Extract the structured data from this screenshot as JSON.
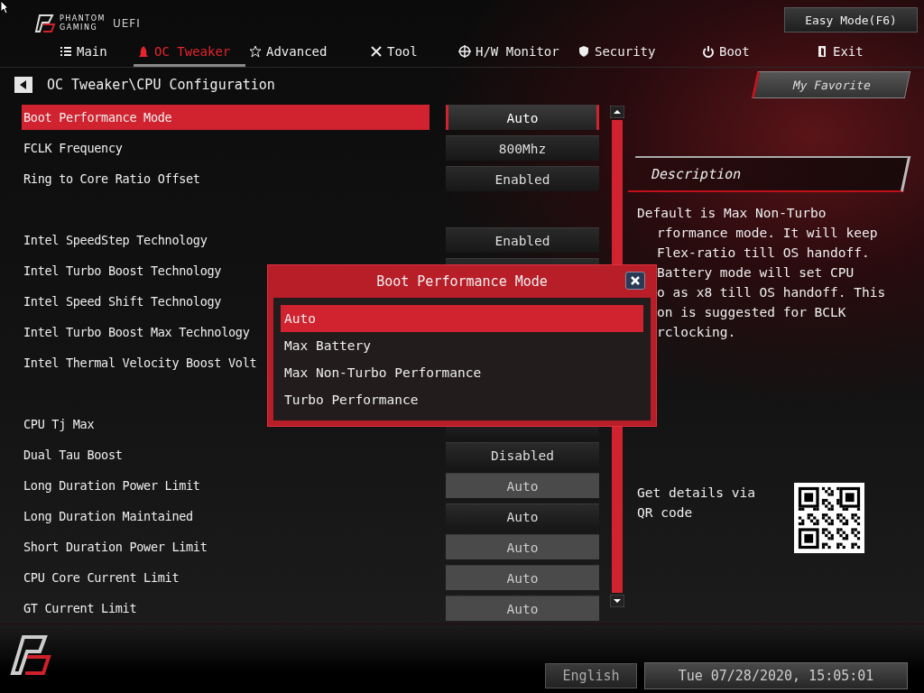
{
  "brand": {
    "name_line1": "PHANTOM",
    "name_line2": "GAMING",
    "suffix": "UEFI"
  },
  "easy_mode_button": "Easy Mode(F6)",
  "tabs": [
    {
      "label": "Main",
      "selected": false
    },
    {
      "label": "OC Tweaker",
      "selected": true
    },
    {
      "label": "Advanced",
      "selected": false
    },
    {
      "label": "Tool",
      "selected": false
    },
    {
      "label": "H/W Monitor",
      "selected": false
    },
    {
      "label": "Security",
      "selected": false
    },
    {
      "label": "Boot",
      "selected": false
    },
    {
      "label": "Exit",
      "selected": false
    }
  ],
  "breadcrumb": "OC Tweaker\\CPU Configuration",
  "favorite_button": "My Favorite",
  "settings": [
    {
      "kind": "setting",
      "label": "Boot Performance Mode",
      "value": "Auto",
      "selected": true,
      "disabled": false
    },
    {
      "kind": "setting",
      "label": "FCLK Frequency",
      "value": "800Mhz",
      "selected": false,
      "disabled": false
    },
    {
      "kind": "setting",
      "label": "Ring to Core Ratio Offset",
      "value": "Enabled",
      "selected": false,
      "disabled": false
    },
    {
      "kind": "spacer"
    },
    {
      "kind": "setting",
      "label": "Intel SpeedStep Technology",
      "value": "Enabled",
      "selected": false,
      "disabled": false
    },
    {
      "kind": "setting",
      "label": "Intel Turbo Boost Technology",
      "selected": false
    },
    {
      "kind": "setting",
      "label": "Intel Speed Shift Technology",
      "selected": false
    },
    {
      "kind": "setting",
      "label": "Intel Turbo Boost Max Technology",
      "selected": false
    },
    {
      "kind": "setting",
      "label": "Intel Thermal Velocity Boost Volt",
      "selected": false
    },
    {
      "kind": "spacer"
    },
    {
      "kind": "setting",
      "label": "CPU Tj Max",
      "selected": false
    },
    {
      "kind": "setting",
      "label": "Dual Tau Boost",
      "value": "Disabled",
      "selected": false,
      "disabled": false
    },
    {
      "kind": "setting",
      "label": "Long Duration Power Limit",
      "value": "Auto",
      "selected": false,
      "disabled": true
    },
    {
      "kind": "setting",
      "label": "Long Duration Maintained",
      "value": "Auto",
      "selected": false,
      "disabled": false
    },
    {
      "kind": "setting",
      "label": "Short Duration Power Limit",
      "value": "Auto",
      "selected": false,
      "disabled": true
    },
    {
      "kind": "setting",
      "label": "CPU Core Current Limit",
      "value": "Auto",
      "selected": false,
      "disabled": true
    },
    {
      "kind": "setting",
      "label": "GT Current Limit",
      "value": "Auto",
      "selected": false,
      "disabled": true
    }
  ],
  "description": {
    "title": "Description",
    "first_line": "Default is Max Non-Turbo",
    "covered_lines": [
      "rformance mode. It will keep",
      "Flex-ratio till OS handoff.",
      "Battery mode will set CPU",
      "o as x8 till OS handoff. This",
      "on is suggested for BCLK",
      "rclocking."
    ]
  },
  "qr": {
    "text": "Get details via QR code"
  },
  "dialog": {
    "title": "Boot Performance Mode",
    "options": [
      {
        "label": "Auto",
        "selected": true
      },
      {
        "label": "Max Battery",
        "selected": false
      },
      {
        "label": "Max Non-Turbo Performance",
        "selected": false
      },
      {
        "label": "Turbo Performance",
        "selected": false
      }
    ]
  },
  "footer": {
    "language": "English",
    "datetime": "Tue 07/28/2020, 15:05:01"
  }
}
